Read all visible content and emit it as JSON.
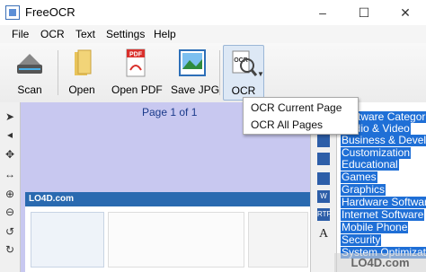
{
  "window": {
    "title": "FreeOCR",
    "minimize": "–",
    "maximize": "☐",
    "close": "✕"
  },
  "menu": [
    "File",
    "OCR",
    "Text",
    "Settings",
    "Help"
  ],
  "toolbar": {
    "scan": "Scan",
    "open": "Open",
    "open_pdf": "Open PDF",
    "save_jpg": "Save JPG",
    "ocr": "OCR"
  },
  "ocr_dropdown": [
    "OCR Current Page",
    "OCR All Pages"
  ],
  "viewer": {
    "page_info": "Page 1 of 1"
  },
  "page_preview": {
    "logo": "LO4D.com"
  },
  "mid_tools": [
    "W",
    "RTF",
    "A"
  ],
  "ocr_text": [
    "Software Categories",
    "Audio & Video",
    "Business & Development",
    "Customization",
    "Educational",
    "Games",
    "Graphics",
    "Hardware Software",
    "Internet Software",
    "Mobile Phone",
    "Security",
    "System Optimization"
  ],
  "watermark": "LO4D.com",
  "colors": {
    "selection": "#1f6fd6",
    "viewer_bg": "#c8c8f0",
    "accent": "#2a6ab0"
  }
}
